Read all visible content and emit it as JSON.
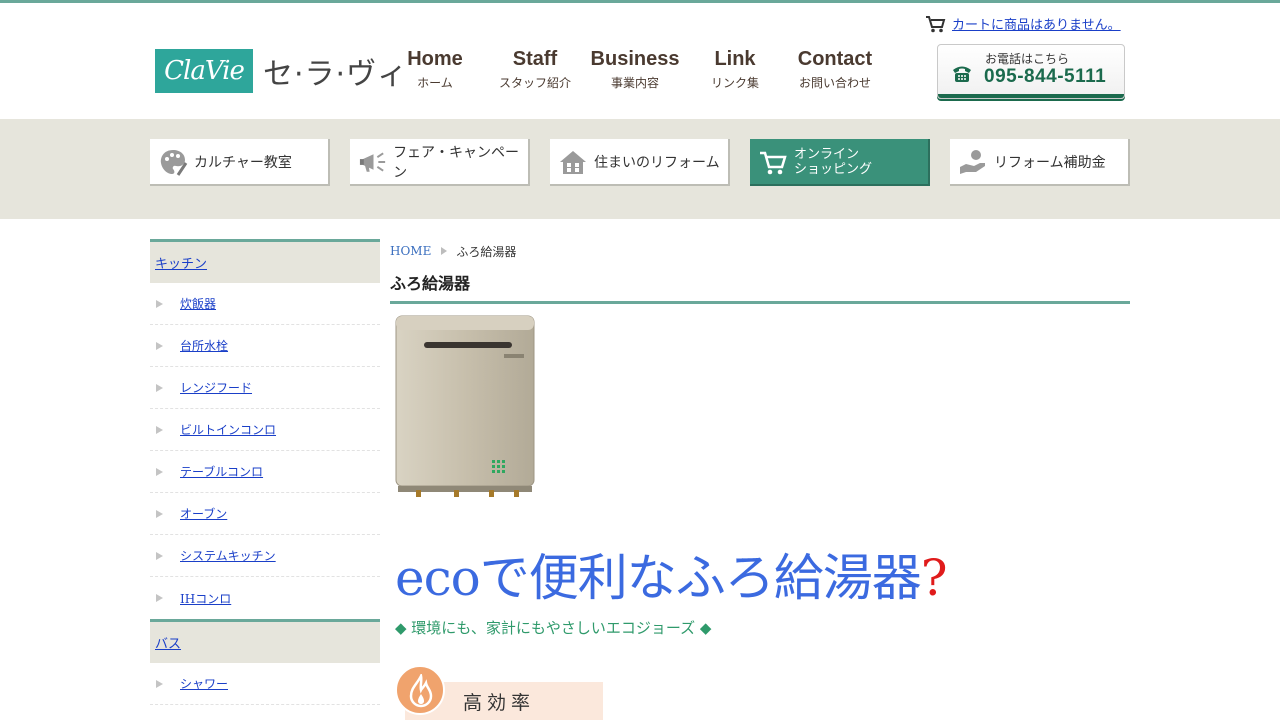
{
  "header": {
    "cart_text": "カートに商品はありません。",
    "logo_text": "ClaVie",
    "logo_kana": "セ·ラ·ヴィ",
    "nav": [
      {
        "en": "Home",
        "ja": "ホーム"
      },
      {
        "en": "Staff",
        "ja": "スタッフ紹介"
      },
      {
        "en": "Business",
        "ja": "事業内容"
      },
      {
        "en": "Link",
        "ja": "リンク集"
      },
      {
        "en": "Contact",
        "ja": "お問い合わせ"
      }
    ],
    "phone_caption": "お電話はこちら",
    "phone_number": "095-844-5111"
  },
  "categories": [
    {
      "label": "カルチャー教室",
      "icon": "palette-icon"
    },
    {
      "label": "フェア・キャンペーン",
      "icon": "megaphone-icon"
    },
    {
      "label": "住まいのリフォーム",
      "icon": "house-icon"
    },
    {
      "label": "オンライン\nショッピング",
      "icon": "cart-icon",
      "active": true
    },
    {
      "label": "リフォーム補助金",
      "icon": "hand-money-icon"
    }
  ],
  "sidebar": {
    "sections": [
      {
        "title": "キッチン",
        "items": [
          "炊飯器",
          "台所水栓",
          "レンジフード",
          "ビルトインコンロ",
          "テーブルコンロ",
          "オーブン",
          "システムキッチン",
          "IHコンロ"
        ]
      },
      {
        "title": "バス",
        "items": [
          "シャワー"
        ]
      }
    ]
  },
  "main": {
    "breadcrumb_home": "HOME",
    "breadcrumb_current": "ふろ給湯器",
    "page_title": "ふろ給湯器",
    "headline": "ecoで便利なふろ給湯器",
    "headline_mark": "?",
    "subline": "◆ 環境にも、家計にもやさしいエコジョーズ ◆",
    "badge_label": "高効率"
  },
  "colors": {
    "accent": "#6aa89a",
    "active_category": "#3a917a",
    "band": "#e6e5dc",
    "headline": "#3b6ae0",
    "link": "#1a3fc8"
  }
}
